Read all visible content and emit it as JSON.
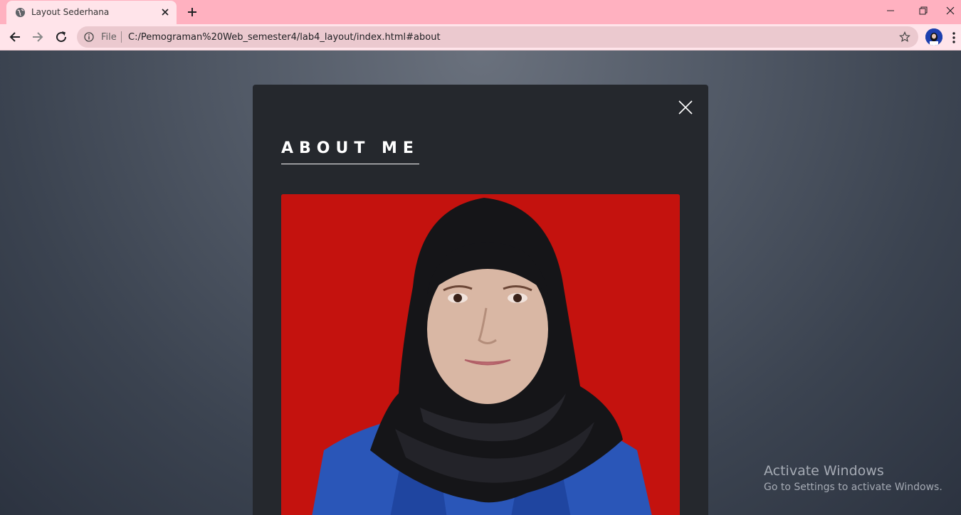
{
  "browser": {
    "tab_title": "Layout Sederhana",
    "omnibox_scheme": "File",
    "url": "C:/Pemograman%20Web_semester4/lab4_layout/index.html#about",
    "icons": {
      "favicon": "globe-icon",
      "tab_close": "close-icon",
      "new_tab": "plus-icon",
      "back": "back-arrow-icon",
      "forward": "forward-arrow-icon",
      "reload": "reload-icon",
      "site_info": "info-icon",
      "bookmark": "star-icon",
      "profile": "avatar",
      "menu": "more-vert-icon",
      "minimize": "minimize-icon",
      "maximize": "restore-icon",
      "window_close": "window-close-icon"
    },
    "colors": {
      "tabstrip": "#ffb1c0",
      "toolbar": "#ffe4ea",
      "omnibox": "#ebc9cf"
    }
  },
  "page": {
    "section_title": "ABOUT ME",
    "close_icon": "close-icon",
    "photo": "portrait photo on red background",
    "colors": {
      "modal": "#25282d",
      "photo_background": "#c4120e"
    }
  },
  "watermark": {
    "title": "Activate Windows",
    "subtitle": "Go to Settings to activate Windows."
  }
}
